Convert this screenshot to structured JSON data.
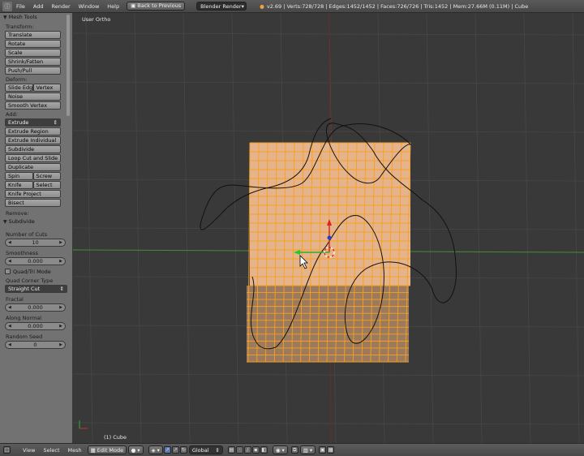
{
  "topbar": {
    "editor_icon": "info-editor-icon",
    "menus": [
      "File",
      "Add",
      "Render",
      "Window",
      "Help"
    ],
    "back_button": "Back to Previous",
    "engine": "Blender Render",
    "stats": "v2.69 | Verts:728/728 | Edges:1452/1452 | Faces:726/726 | Tris:1452 | Mem:27.66M (0.11M) | Cube"
  },
  "toolshelf": {
    "panel_title": "Mesh Tools",
    "transform_label": "Transform:",
    "transform": [
      "Translate",
      "Rotate",
      "Scale",
      "Shrink/Fatten",
      "Push/Pull"
    ],
    "deform_label": "Deform:",
    "slide_edge": "Slide Edge",
    "vertex": "Vertex",
    "noise": "Noise",
    "smooth_vertex": "Smooth Vertex",
    "add_label": "Add:",
    "extrude": "Extrude",
    "add_items": [
      "Extrude Region",
      "Extrude Individual",
      "Subdivide",
      "Loop Cut and Slide",
      "Duplicate"
    ],
    "spin": "Spin",
    "screw": "Screw",
    "knife": "Knife",
    "select": "Select",
    "knife_project": "Knife Project",
    "bisect": "Bisect",
    "remove_label": "Remove:"
  },
  "operator": {
    "title": "Subdivide",
    "number_of_cuts_label": "Number of Cuts",
    "number_of_cuts": "10",
    "smoothness_label": "Smoothness",
    "smoothness": "0.000",
    "quad_tri_label": "Quad/Tri Mode",
    "quad_corner_label": "Quad Corner Type",
    "quad_corner": "Straight Cut",
    "fractal_label": "Fractal",
    "fractal": "0.000",
    "along_normal_label": "Along Normal",
    "along_normal": "0.000",
    "random_seed_label": "Random Seed",
    "random_seed": "0"
  },
  "viewport": {
    "view_name": "User Ortho",
    "object_name": "(1) Cube",
    "colors": {
      "background": "#393939",
      "grid": "#474747",
      "face_selected": "#e7b48c",
      "edge_selected": "#f7a01c",
      "x_axis": "#6b2a2a",
      "y_axis": "#4a8a3a"
    }
  },
  "bottombar": {
    "editor_icon": "3d-view-icon",
    "menus": [
      "View",
      "Select",
      "Mesh"
    ],
    "mode": "Edit Mode",
    "orientation": "Global"
  }
}
